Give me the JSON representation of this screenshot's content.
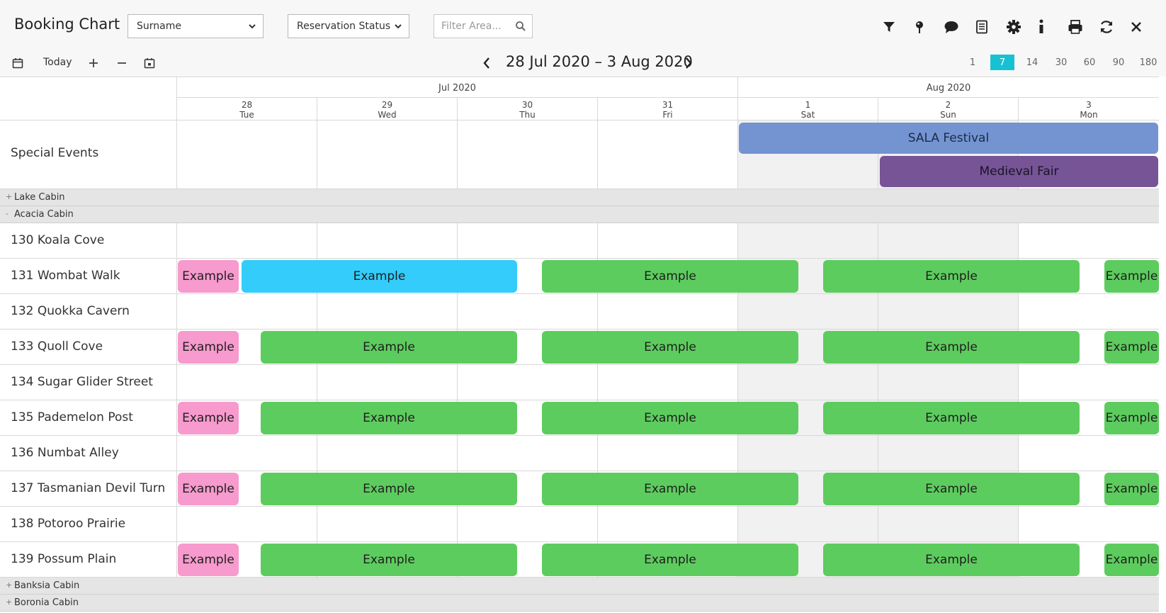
{
  "header": {
    "title": "Booking Chart",
    "sort_select": "Surname",
    "status_select": "Reservation Status",
    "filter_placeholder": "Filter Area..."
  },
  "toolbar_icons": [
    "filter-icon",
    "pin-icon",
    "comment-icon",
    "report-icon",
    "gear-icon",
    "info-icon",
    "print-icon",
    "refresh-icon",
    "close-icon"
  ],
  "nav": {
    "today": "Today",
    "range": "28 Jul 2020 – 3 Aug 2020",
    "zoom_options": [
      "1",
      "7",
      "14",
      "30",
      "60",
      "90",
      "180"
    ],
    "zoom_active": "7"
  },
  "calendar": {
    "months": [
      "Jul 2020",
      "Aug 2020"
    ],
    "days": [
      {
        "num": "28",
        "dow": "Tue"
      },
      {
        "num": "29",
        "dow": "Wed"
      },
      {
        "num": "30",
        "dow": "Thu"
      },
      {
        "num": "31",
        "dow": "Fri"
      },
      {
        "num": "1",
        "dow": "Sat"
      },
      {
        "num": "2",
        "dow": "Sun"
      },
      {
        "num": "3",
        "dow": "Mon"
      }
    ]
  },
  "special_events": {
    "label": "Special Events",
    "events": [
      {
        "name": "SALA Festival",
        "color": "#7494d1"
      },
      {
        "name": "Medieval Fair",
        "color": "#765496"
      }
    ]
  },
  "groups": {
    "lake": {
      "toggle": "+",
      "name": "Lake Cabin"
    },
    "acacia": {
      "toggle": "-",
      "name": "Acacia Cabin"
    },
    "banksia": {
      "toggle": "+",
      "name": "Banksia Cabin"
    },
    "boronia": {
      "toggle": "+",
      "name": "Boronia Cabin"
    }
  },
  "rooms": [
    "130 Koala Cove",
    "131 Wombat Walk",
    "132 Quokka Cavern",
    "133 Quoll Cove",
    "134 Sugar Glider Street",
    "135 Pademelon Post",
    "136 Numbat Alley",
    "137 Tasmanian Devil Turn",
    "138 Potoroo Prairie",
    "139 Possum Plain"
  ],
  "booking_label": "Example",
  "colors": {
    "pink": "#f79acd",
    "cyan": "#33ccfb",
    "green": "#5dcc5e",
    "accent": "#17c1d4"
  }
}
